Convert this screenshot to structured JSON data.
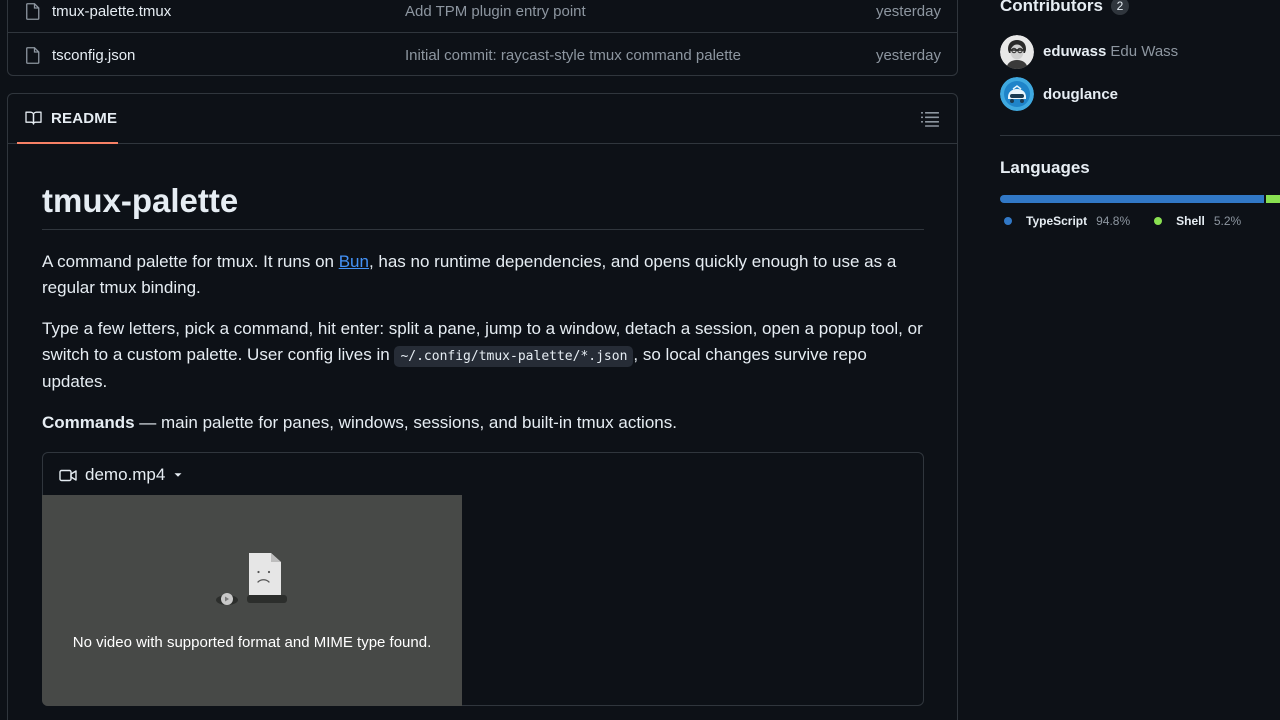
{
  "files": [
    {
      "name": "tmux-palette.tmux",
      "message": "Add TPM plugin entry point",
      "date": "yesterday"
    },
    {
      "name": "tsconfig.json",
      "message": "Initial commit: raycast-style tmux command palette",
      "date": "yesterday"
    }
  ],
  "readme": {
    "tab_label": "README",
    "title": "tmux-palette",
    "p1_before": "A command palette for tmux. It runs on ",
    "p1_link": "Bun",
    "p1_after": ", has no runtime dependencies, and opens quickly enough to use as a regular tmux binding.",
    "p2_before": "Type a few letters, pick a command, hit enter: split a pane, jump to a window, detach a session, open a popup tool, or switch to a custom palette. User config lives in ",
    "p2_code": "~/.config/tmux-palette/*.json",
    "p2_after": ", so local changes survive repo updates.",
    "p3_strong": "Commands",
    "p3_rest": " — main palette for panes, windows, sessions, and built-in tmux actions.",
    "video_title": "demo.mp4",
    "video_error": "No video with supported format and MIME type found."
  },
  "sidebar": {
    "contributors_title": "Contributors",
    "contributors_count": "2",
    "contributors": [
      {
        "login": "eduwass",
        "name": "Edu Wass"
      },
      {
        "login": "douglance",
        "name": ""
      }
    ],
    "languages_title": "Languages",
    "languages": [
      {
        "name": "TypeScript",
        "percent": "94.8%",
        "value": 94.8,
        "color": "#3178c6"
      },
      {
        "name": "Shell",
        "percent": "5.2%",
        "value": 5.2,
        "color": "#89e051"
      }
    ]
  }
}
